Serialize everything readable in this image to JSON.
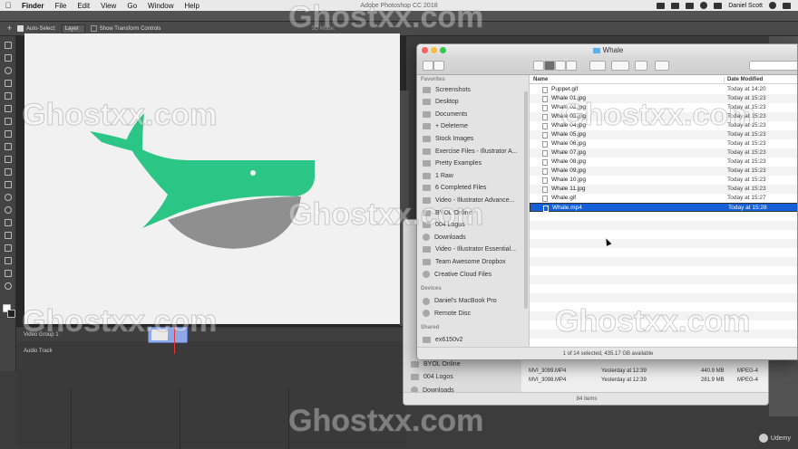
{
  "menubar": {
    "items": [
      "Finder",
      "File",
      "Edit",
      "View",
      "Go",
      "Window",
      "Help"
    ],
    "app_title": "Adobe Photoshop CC 2018",
    "user": "Daniel Scott"
  },
  "ps_options": {
    "auto_select_label": "Auto-Select:",
    "auto_select_value": "Layer",
    "transform_label": "Show Transform Controls",
    "mode_label": "3D Mode:"
  },
  "timeline": {
    "video_group": "Video Group 1",
    "audio_track": "Audio Track"
  },
  "finder_back": {
    "sidebar": [
      "BYOL Online",
      "004 Logos",
      "Downloads"
    ],
    "rows": [
      {
        "name": "MVI_3099.MP4",
        "date": "Yesterday at 12:39",
        "size": "440.9 MB",
        "kind": "MPEG-4"
      },
      {
        "name": "MVI_3098.MP4",
        "date": "Yesterday at 12:39",
        "size": "281.9 MB",
        "kind": "MPEG-4"
      }
    ],
    "status": "84 items"
  },
  "finder": {
    "title": "Whale",
    "sidebar": {
      "favorites_label": "Favorites",
      "favorites": [
        "Screenshots",
        "Desktop",
        "Documents",
        "+ Deleteme",
        "Stock Images",
        "Exercise Files - Illustrator A...",
        "Pretty Examples",
        "1 Raw",
        "6 Completed Files",
        "Video - Illustrator Advance...",
        "BYOL Online",
        "004 Logos",
        "Downloads",
        "Video - Illustrator Essential...",
        "Team Awesome Dropbox",
        "Creative Cloud Files"
      ],
      "devices_label": "Devices",
      "devices": [
        "Daniel's MacBook Pro",
        "Remote Disc"
      ],
      "shared_label": "Shared",
      "shared": [
        "ex6150v2"
      ]
    },
    "columns": {
      "name": "Name",
      "date": "Date Modified"
    },
    "files": [
      {
        "name": "Puppet.gif",
        "date": "Today at 14:20"
      },
      {
        "name": "Whale 01.jpg",
        "date": "Today at 15:23"
      },
      {
        "name": "Whale 02.jpg",
        "date": "Today at 15:23"
      },
      {
        "name": "Whale 03.jpg",
        "date": "Today at 15:23"
      },
      {
        "name": "Whale 04.jpg",
        "date": "Today at 15:23"
      },
      {
        "name": "Whale 05.jpg",
        "date": "Today at 15:23"
      },
      {
        "name": "Whale 06.jpg",
        "date": "Today at 15:23"
      },
      {
        "name": "Whale 07.jpg",
        "date": "Today at 15:23"
      },
      {
        "name": "Whale 08.jpg",
        "date": "Today at 15:23"
      },
      {
        "name": "Whale 09.jpg",
        "date": "Today at 15:23"
      },
      {
        "name": "Whale 10.jpg",
        "date": "Today at 15:23"
      },
      {
        "name": "Whale 11.jpg",
        "date": "Today at 15:23"
      },
      {
        "name": "Whale.gif",
        "date": "Today at 15:27"
      },
      {
        "name": "Whale.mp4",
        "date": "Today at 15:28"
      }
    ],
    "status": "1 of 14 selected, 435.17 GB available"
  },
  "watermark": "Ghostxx.com",
  "udemy": "Udemy",
  "colors": {
    "whale_green": "#2bc585",
    "whale_gray": "#8f8f8f",
    "selection_blue": "#1560d6"
  }
}
